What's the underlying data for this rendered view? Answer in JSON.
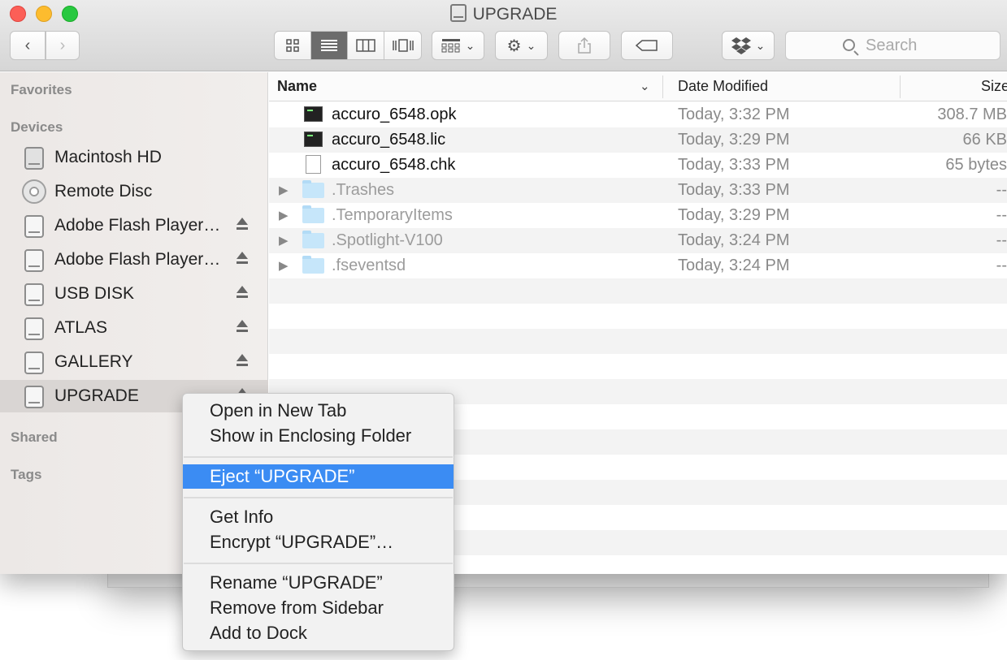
{
  "window": {
    "title": "UPGRADE"
  },
  "toolbar": {
    "back": "‹",
    "forward": "›",
    "view_modes": [
      "icon-view",
      "list-view",
      "column-view",
      "coverflow-view"
    ],
    "active_view": "list-view",
    "search_placeholder": "Search"
  },
  "sidebar": {
    "favorites": "Favorites",
    "devices": "Devices",
    "shared": "Shared",
    "tags": "Tags",
    "items": [
      {
        "label": "Macintosh HD",
        "icon": "hard-disk-icon",
        "eject": false
      },
      {
        "label": "Remote Disc",
        "icon": "disc-icon",
        "eject": false
      },
      {
        "label": "Adobe Flash Player…",
        "icon": "drive-icon",
        "eject": true
      },
      {
        "label": "Adobe Flash Player…",
        "icon": "drive-icon",
        "eject": true
      },
      {
        "label": "USB DISK",
        "icon": "drive-icon",
        "eject": true
      },
      {
        "label": "ATLAS",
        "icon": "drive-icon",
        "eject": true
      },
      {
        "label": "GALLERY",
        "icon": "drive-icon",
        "eject": true
      },
      {
        "label": "UPGRADE",
        "icon": "drive-icon",
        "eject": true,
        "selected": true
      }
    ]
  },
  "columns": {
    "name": "Name",
    "date": "Date Modified",
    "size": "Size"
  },
  "files": [
    {
      "name": "accuro_6548.opk",
      "date": "Today, 3:32 PM",
      "size": "308.7 MB",
      "icon": "terminal-file-icon",
      "hidden": false,
      "folder": false
    },
    {
      "name": "accuro_6548.lic",
      "date": "Today, 3:29 PM",
      "size": "66 KB",
      "icon": "terminal-file-icon",
      "hidden": false,
      "folder": false
    },
    {
      "name": "accuro_6548.chk",
      "date": "Today, 3:33 PM",
      "size": "65 bytes",
      "icon": "document-icon",
      "hidden": false,
      "folder": false
    },
    {
      "name": ".Trashes",
      "date": "Today, 3:33 PM",
      "size": "--",
      "icon": "folder-icon",
      "hidden": true,
      "folder": true
    },
    {
      "name": ".TemporaryItems",
      "date": "Today, 3:29 PM",
      "size": "--",
      "icon": "folder-icon",
      "hidden": true,
      "folder": true
    },
    {
      "name": ".Spotlight-V100",
      "date": "Today, 3:24 PM",
      "size": "--",
      "icon": "folder-icon",
      "hidden": true,
      "folder": true
    },
    {
      "name": ".fseventsd",
      "date": "Today, 3:24 PM",
      "size": "--",
      "icon": "folder-icon",
      "hidden": true,
      "folder": true
    }
  ],
  "context_menu": {
    "open_new_tab": "Open in New Tab",
    "show_enclosing": "Show in Enclosing Folder",
    "eject": "Eject “UPGRADE”",
    "get_info": "Get Info",
    "encrypt": "Encrypt “UPGRADE”…",
    "rename": "Rename “UPGRADE”",
    "remove_sidebar": "Remove from Sidebar",
    "add_dock": "Add to Dock"
  },
  "colors": {
    "highlight": "#3b8cf3",
    "close": "#fc5f57",
    "minimize": "#fdbc2e",
    "zoom": "#28c840"
  }
}
